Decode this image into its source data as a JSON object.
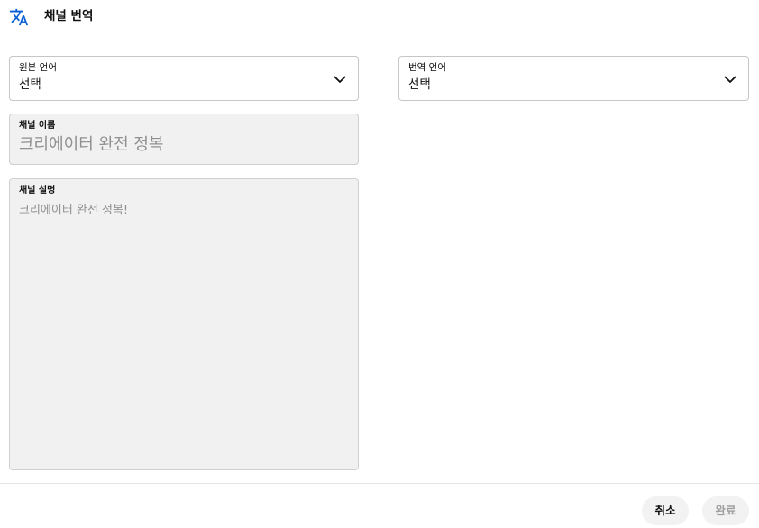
{
  "header": {
    "icon": "translate-icon",
    "title": "채널 번역"
  },
  "source_language": {
    "label": "원본 언어",
    "value": "선택",
    "icon": "chevron-down-icon"
  },
  "target_language": {
    "label": "번역 언어",
    "value": "선택",
    "icon": "chevron-down-icon"
  },
  "channel_name": {
    "label": "채널 이름",
    "value": "크리에이터 완전 정복"
  },
  "channel_description": {
    "label": "채널 설명",
    "value": "크리에이터 완전 정복!"
  },
  "footer": {
    "cancel_label": "취소",
    "done_label": "완료"
  },
  "colors": {
    "accent": "#065fd4",
    "disabled_text": "#909090",
    "disabled_background": "#f1f1f1"
  }
}
